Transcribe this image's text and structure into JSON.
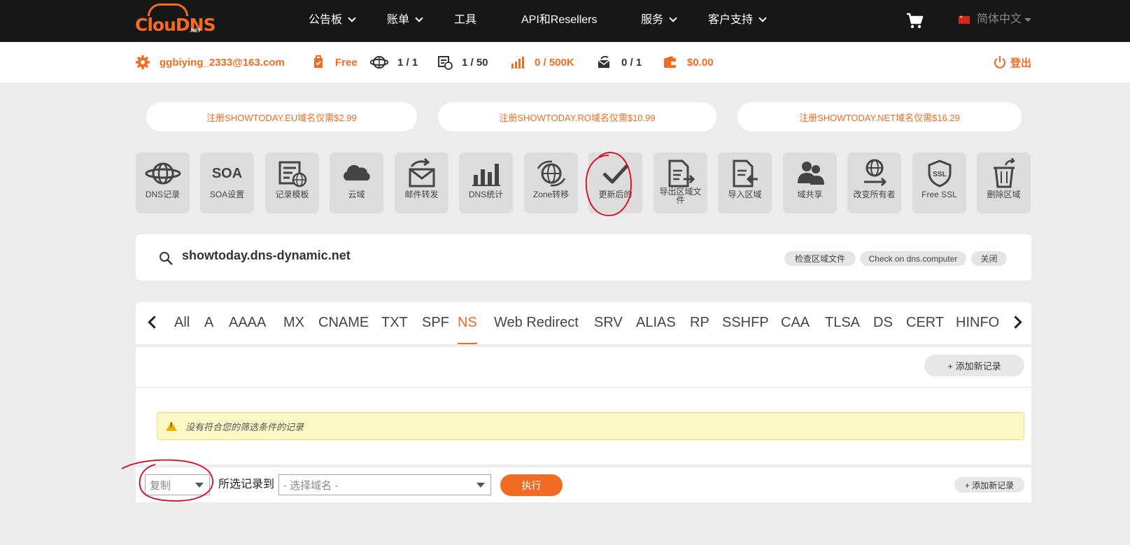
{
  "brand": {
    "logo_text": "ClouDNS",
    "logo_suffix": ".NET"
  },
  "nav": {
    "items": [
      {
        "label": "公告板",
        "has_dropdown": true
      },
      {
        "label": "账单",
        "has_dropdown": true
      },
      {
        "label": "工具",
        "has_dropdown": false
      },
      {
        "label": "API和Resellers",
        "has_dropdown": false
      },
      {
        "label": "服务",
        "has_dropdown": true
      },
      {
        "label": "客户支持",
        "has_dropdown": true
      }
    ],
    "cart_icon": "shopping-cart-icon",
    "language": "简体中文"
  },
  "userbar": {
    "email": "ggbiying_2333@163.com",
    "plan": "Free",
    "zones": "1 / 1",
    "records": "1 / 50",
    "queries": "0 / 500K",
    "mail_forwards": "0 / 1",
    "balance": "$0.00",
    "logout": "登出"
  },
  "promos": [
    "注册SHOWTODAY.EU域名仅需$2.99",
    "注册SHOWTODAY.RO域名仅需$10.99",
    "注册SHOWTODAY.NET域名仅需$16.29"
  ],
  "tools": [
    {
      "label": "DNS记录",
      "icon": "globe-icon"
    },
    {
      "label": "SOA设置",
      "icon": "soa-icon",
      "icon_text": "SOA"
    },
    {
      "label": "记录模板",
      "icon": "template-icon"
    },
    {
      "label": "云域",
      "icon": "cloud-icon"
    },
    {
      "label": "邮件转发",
      "icon": "mail-forward-icon"
    },
    {
      "label": "DNS统计",
      "icon": "bar-chart-icon"
    },
    {
      "label": "Zone转移",
      "icon": "globe-transfer-icon"
    },
    {
      "label": "更新后的",
      "icon": "checkmark-icon"
    },
    {
      "label": "导出区域文件",
      "icon": "export-file-icon"
    },
    {
      "label": "导入区域",
      "icon": "import-file-icon"
    },
    {
      "label": "域共享",
      "icon": "users-icon"
    },
    {
      "label": "改变所有者",
      "icon": "change-owner-icon"
    },
    {
      "label": "Free SSL",
      "icon": "ssl-shield-icon",
      "icon_text": "SSL"
    },
    {
      "label": "删除区域",
      "icon": "trash-icon"
    }
  ],
  "domain": {
    "name": "showtoday.dns-dynamic.net",
    "actions": [
      "检查区域文件",
      "Check on dns.computer",
      "关闭"
    ]
  },
  "record_tabs": {
    "items": [
      "All",
      "A",
      "AAAA",
      "MX",
      "CNAME",
      "TXT",
      "SPF",
      "NS",
      "Web Redirect",
      "SRV",
      "ALIAS",
      "RP",
      "SSHFP",
      "CAA",
      "TLSA",
      "DS",
      "CERT",
      "HINFO"
    ],
    "active": "NS"
  },
  "panel": {
    "add_record": "+ 添加新记录",
    "empty_message": "没有符合您的筛选条件的记录"
  },
  "bottom": {
    "action_select": "复制",
    "selected_to": "所选记录到",
    "domain_select_placeholder": "- 选择域名 -",
    "execute": "执行",
    "add_record": "+ 添加新记录"
  },
  "colors": {
    "accent": "#f26b22",
    "nav_bg": "#171717",
    "page_bg": "#ececec",
    "tile_bg": "#dcdcdc",
    "annotation": "#e0001a"
  }
}
